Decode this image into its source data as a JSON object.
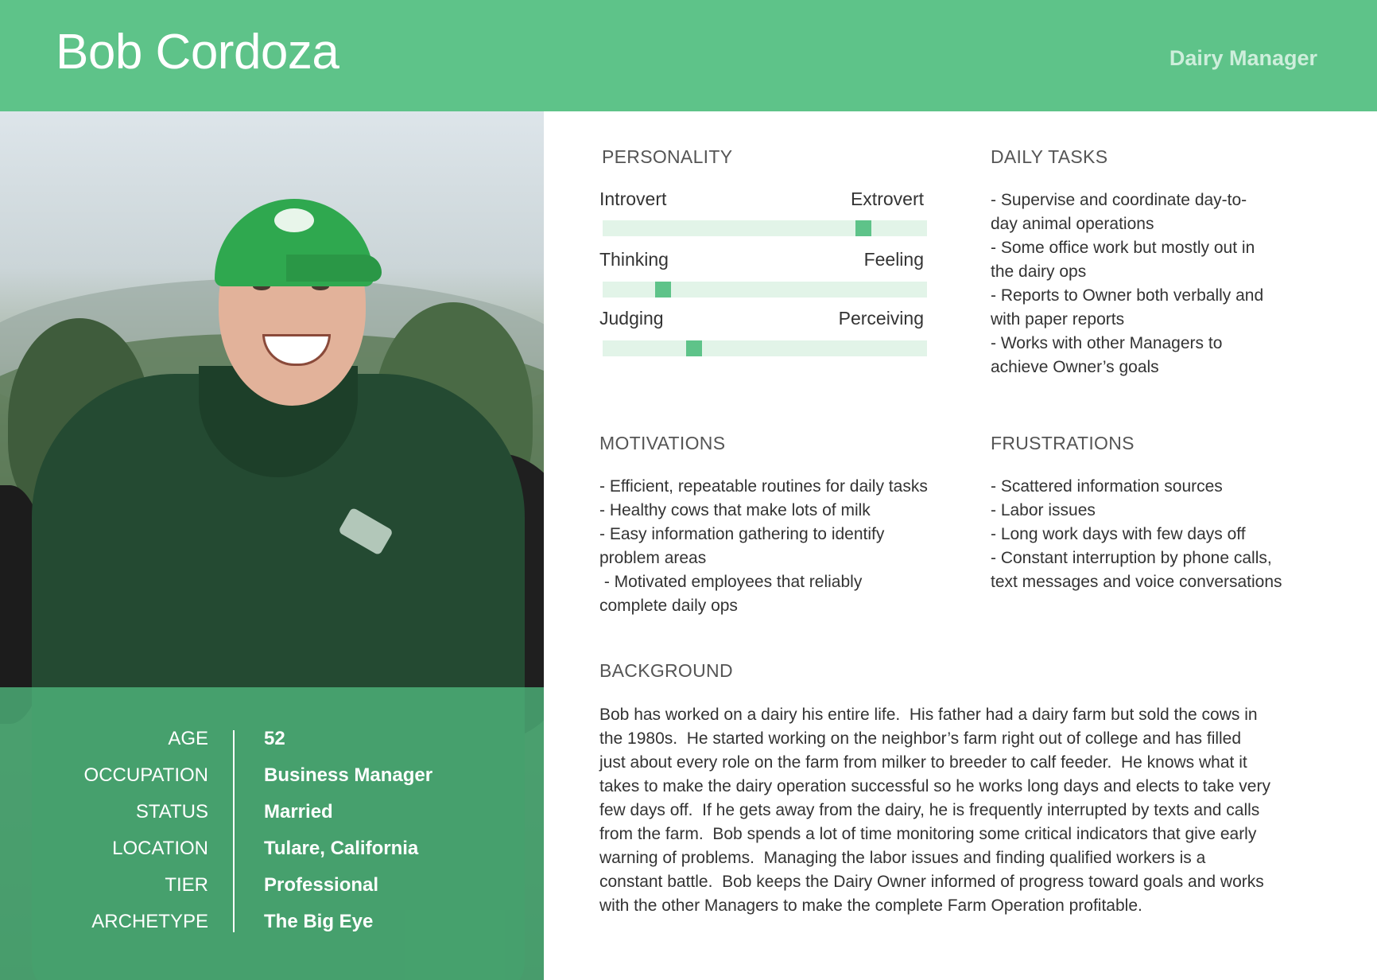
{
  "header": {
    "name": "Bob Cordoza",
    "role": "Dairy Manager"
  },
  "colors": {
    "accent": "#5ec389",
    "slider_track": "#e2f4e8"
  },
  "profile": [
    {
      "label": "AGE",
      "value": "52"
    },
    {
      "label": "OCCUPATION",
      "value": "Business Manager"
    },
    {
      "label": "STATUS",
      "value": "Married"
    },
    {
      "label": "LOCATION",
      "value": "Tulare, California"
    },
    {
      "label": "TIER",
      "value": "Professional"
    },
    {
      "label": "ARCHETYPE",
      "value": "The Big Eye"
    }
  ],
  "personality": {
    "title": "PERSONALITY",
    "traits": [
      {
        "left": "Introvert",
        "right": "Extrovert",
        "position": 0.82
      },
      {
        "left": "Thinking",
        "right": "Feeling",
        "position": 0.17
      },
      {
        "left": "Judging",
        "right": "Perceiving",
        "position": 0.27
      }
    ]
  },
  "daily_tasks": {
    "title": "DAILY TASKS",
    "lines": [
      "- Supervise and coordinate day-to-",
      "day animal operations",
      "- Some office work but mostly out in",
      "the dairy ops",
      "- Reports to Owner both verbally and",
      "with paper reports",
      "- Works with other Managers to",
      "achieve Owner’s goals"
    ]
  },
  "motivations": {
    "title": "MOTIVATIONS",
    "lines": [
      "- Efficient, repeatable routines for daily tasks",
      "- Healthy cows that make lots of milk",
      "- Easy information gathering to identify",
      "problem areas",
      " - Motivated employees that reliably",
      "complete daily ops"
    ]
  },
  "frustrations": {
    "title": "FRUSTRATIONS",
    "lines": [
      "- Scattered information sources",
      "- Labor issues",
      "- Long work days with few days off",
      "- Constant interruption by phone calls,",
      "text messages and voice conversations"
    ]
  },
  "background": {
    "title": "BACKGROUND",
    "lines": [
      "Bob has worked on a dairy his entire life.  His father had a dairy farm but sold the cows in",
      "the 1980s.  He started working on the neighbor’s farm right out of college and has filled",
      "just about every role on the farm from milker to breeder to calf feeder.  He knows what it",
      "takes to make the dairy operation successful so he works long days and elects to take very",
      "few days off.  If he gets away from the dairy, he is frequently interrupted by texts and calls",
      "from the farm.  Bob spends a lot of time monitoring some critical indicators that give early",
      "warning of problems.  Managing the labor issues and finding qualified workers is a",
      "constant battle.  Bob keeps the Dairy Owner informed of progress toward goals and works",
      "with the other Managers to make the complete Farm Operation profitable."
    ]
  }
}
